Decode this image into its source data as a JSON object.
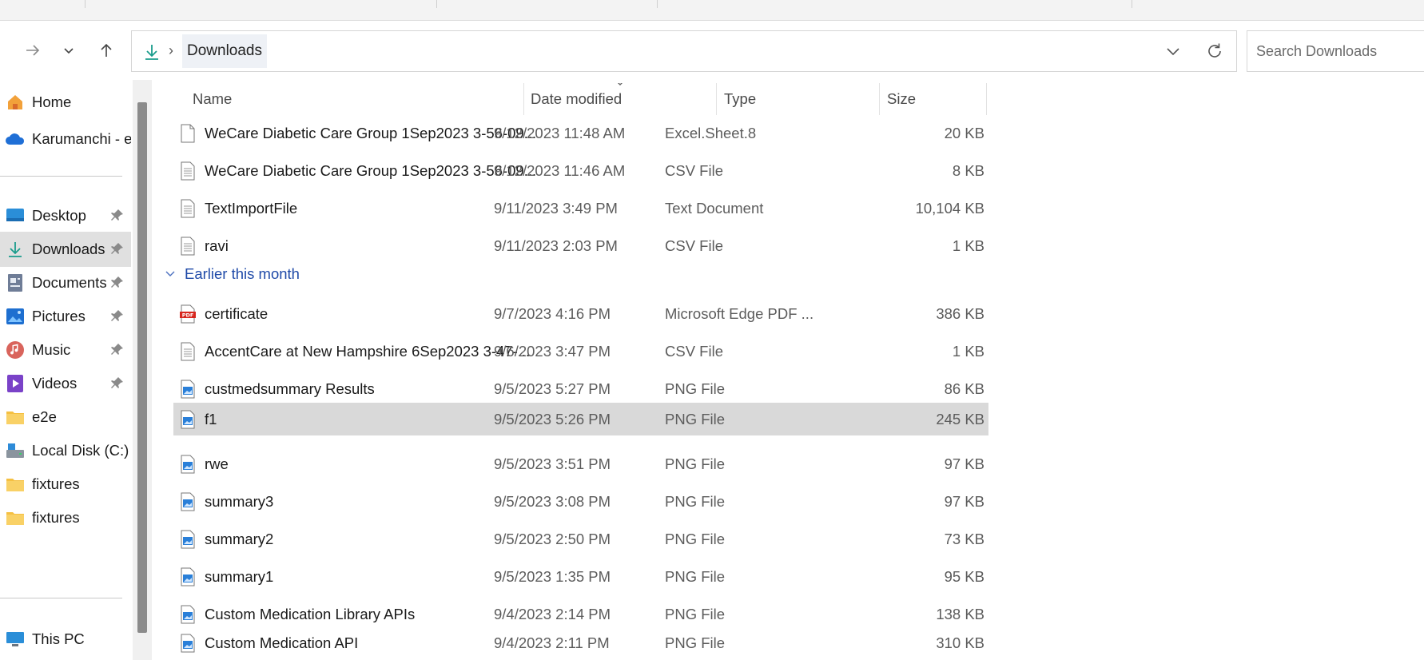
{
  "address_bar": {
    "breadcrumb": "Downloads",
    "search_placeholder": "Search Downloads"
  },
  "sidebar": {
    "items": [
      {
        "label": "Home",
        "icon": "home-icon",
        "pinned": false
      },
      {
        "label": "Karumanchi - em",
        "icon": "onedrive-cloud-icon",
        "pinned": false
      },
      {
        "label": "Desktop",
        "icon": "desktop-icon",
        "pinned": true
      },
      {
        "label": "Downloads",
        "icon": "download-icon",
        "pinned": true,
        "selected": true
      },
      {
        "label": "Documents",
        "icon": "documents-icon",
        "pinned": true
      },
      {
        "label": "Pictures",
        "icon": "pictures-icon",
        "pinned": true
      },
      {
        "label": "Music",
        "icon": "music-icon",
        "pinned": true
      },
      {
        "label": "Videos",
        "icon": "videos-icon",
        "pinned": true
      },
      {
        "label": "e2e",
        "icon": "folder-icon",
        "pinned": false
      },
      {
        "label": "Local Disk (C:)",
        "icon": "drive-icon",
        "pinned": false
      },
      {
        "label": "fixtures",
        "icon": "folder-icon",
        "pinned": false
      },
      {
        "label": "fixtures",
        "icon": "folder-icon",
        "pinned": false
      },
      {
        "label": "This PC",
        "icon": "this-pc-icon",
        "pinned": false
      }
    ]
  },
  "columns": {
    "name": "Name",
    "date": "Date modified",
    "type": "Type",
    "size": "Size"
  },
  "group_earlier": "Earlier this month",
  "files": [
    {
      "name": "WeCare Diabetic Care Group 1Sep2023 3-56-09...",
      "date": "9/12/2023 11:48 AM",
      "type": "Excel.Sheet.8",
      "size": "20 KB",
      "icon": "file-icon"
    },
    {
      "name": "WeCare Diabetic Care Group 1Sep2023 3-56-09...",
      "date": "9/12/2023 11:46 AM",
      "type": "CSV File",
      "size": "8 KB",
      "icon": "text-file-icon"
    },
    {
      "name": "TextImportFile",
      "date": "9/11/2023 3:49 PM",
      "type": "Text Document",
      "size": "10,104 KB",
      "icon": "text-file-icon"
    },
    {
      "name": "ravi",
      "date": "9/11/2023 2:03 PM",
      "type": "CSV File",
      "size": "1 KB",
      "icon": "text-file-icon"
    },
    {
      "name": "certificate",
      "date": "9/7/2023 4:16 PM",
      "type": "Microsoft Edge PDF ...",
      "size": "386 KB",
      "icon": "pdf-file-icon"
    },
    {
      "name": "AccentCare at New Hampshire 6Sep2023 3-47-...",
      "date": "9/6/2023 3:47 PM",
      "type": "CSV File",
      "size": "1 KB",
      "icon": "text-file-icon"
    },
    {
      "name": "custmedsummary Results",
      "date": "9/5/2023 5:27 PM",
      "type": "PNG File",
      "size": "86 KB",
      "icon": "image-file-icon"
    },
    {
      "name": "f1",
      "date": "9/5/2023 5:26 PM",
      "type": "PNG File",
      "size": "245 KB",
      "icon": "image-file-icon",
      "selected": true
    },
    {
      "name": "rwe",
      "date": "9/5/2023 3:51 PM",
      "type": "PNG File",
      "size": "97 KB",
      "icon": "image-file-icon"
    },
    {
      "name": "summary3",
      "date": "9/5/2023 3:08 PM",
      "type": "PNG File",
      "size": "97 KB",
      "icon": "image-file-icon"
    },
    {
      "name": "summary2",
      "date": "9/5/2023 2:50 PM",
      "type": "PNG File",
      "size": "73 KB",
      "icon": "image-file-icon"
    },
    {
      "name": "summary1",
      "date": "9/5/2023 1:35 PM",
      "type": "PNG File",
      "size": "95 KB",
      "icon": "image-file-icon"
    },
    {
      "name": "Custom Medication Library APIs",
      "date": "9/4/2023 2:14 PM",
      "type": "PNG File",
      "size": "138 KB",
      "icon": "image-file-icon"
    },
    {
      "name": "Custom Medication API",
      "date": "9/4/2023 2:11 PM",
      "type": "PNG File",
      "size": "310 KB",
      "icon": "image-file-icon"
    }
  ]
}
